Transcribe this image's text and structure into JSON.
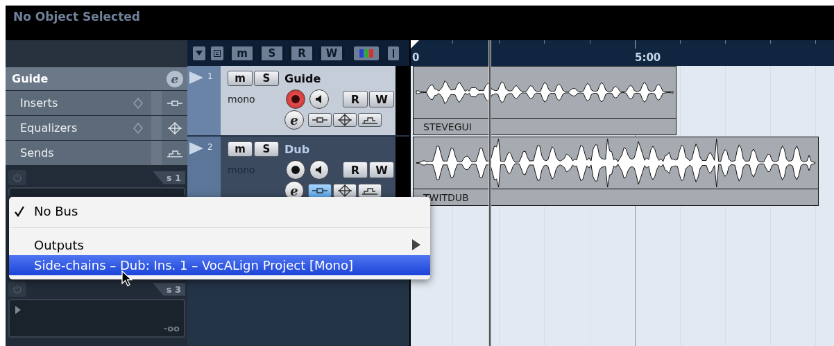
{
  "header": {
    "title": "No Object Selected"
  },
  "toolbar": {
    "buttons": [
      {
        "kind": "dropdown"
      },
      {
        "kind": "list"
      },
      {
        "kind": "letter",
        "label": "m"
      },
      {
        "kind": "letter",
        "label": "S"
      },
      {
        "kind": "letter",
        "label": "R"
      },
      {
        "kind": "letter",
        "label": "W"
      },
      {
        "kind": "colors"
      },
      {
        "kind": "divider"
      }
    ]
  },
  "ruler": {
    "labels": [
      "0",
      "5:00"
    ]
  },
  "inspector": {
    "track_name": "Guide",
    "edit_label": "e",
    "sections": [
      {
        "label": "Inserts",
        "kind": "inserts"
      },
      {
        "label": "Equalizers",
        "kind": "eq"
      },
      {
        "label": "Sends",
        "kind": "sends"
      }
    ],
    "slots": [
      {
        "label": "s 1"
      },
      {
        "label": "s 3",
        "value": "-oo"
      }
    ]
  },
  "tracks": [
    {
      "number": "1",
      "name": "Guide",
      "channel": "mono",
      "selected": true,
      "record": true,
      "insert_active": false,
      "mute_label": "m",
      "solo_label": "S",
      "read_label": "R",
      "write_label": "W",
      "edit_label": "e",
      "event": {
        "name": "STEVEGUI"
      }
    },
    {
      "number": "2",
      "name": "Dub",
      "channel": "mono",
      "selected": false,
      "record": false,
      "insert_active": true,
      "mute_label": "m",
      "solo_label": "S",
      "read_label": "R",
      "write_label": "W",
      "edit_label": "e",
      "event": {
        "name": "TWITDUB"
      }
    }
  ],
  "menu": {
    "items": [
      {
        "kind": "item",
        "label": "No Bus",
        "checked": true,
        "selected": false
      },
      {
        "kind": "separator"
      },
      {
        "kind": "submenu",
        "label": "Outputs",
        "checked": false,
        "selected": false
      },
      {
        "kind": "item",
        "label": "Side-chains – Dub: Ins. 1 – VocALign Project [Mono]",
        "checked": false,
        "selected": true
      }
    ]
  }
}
